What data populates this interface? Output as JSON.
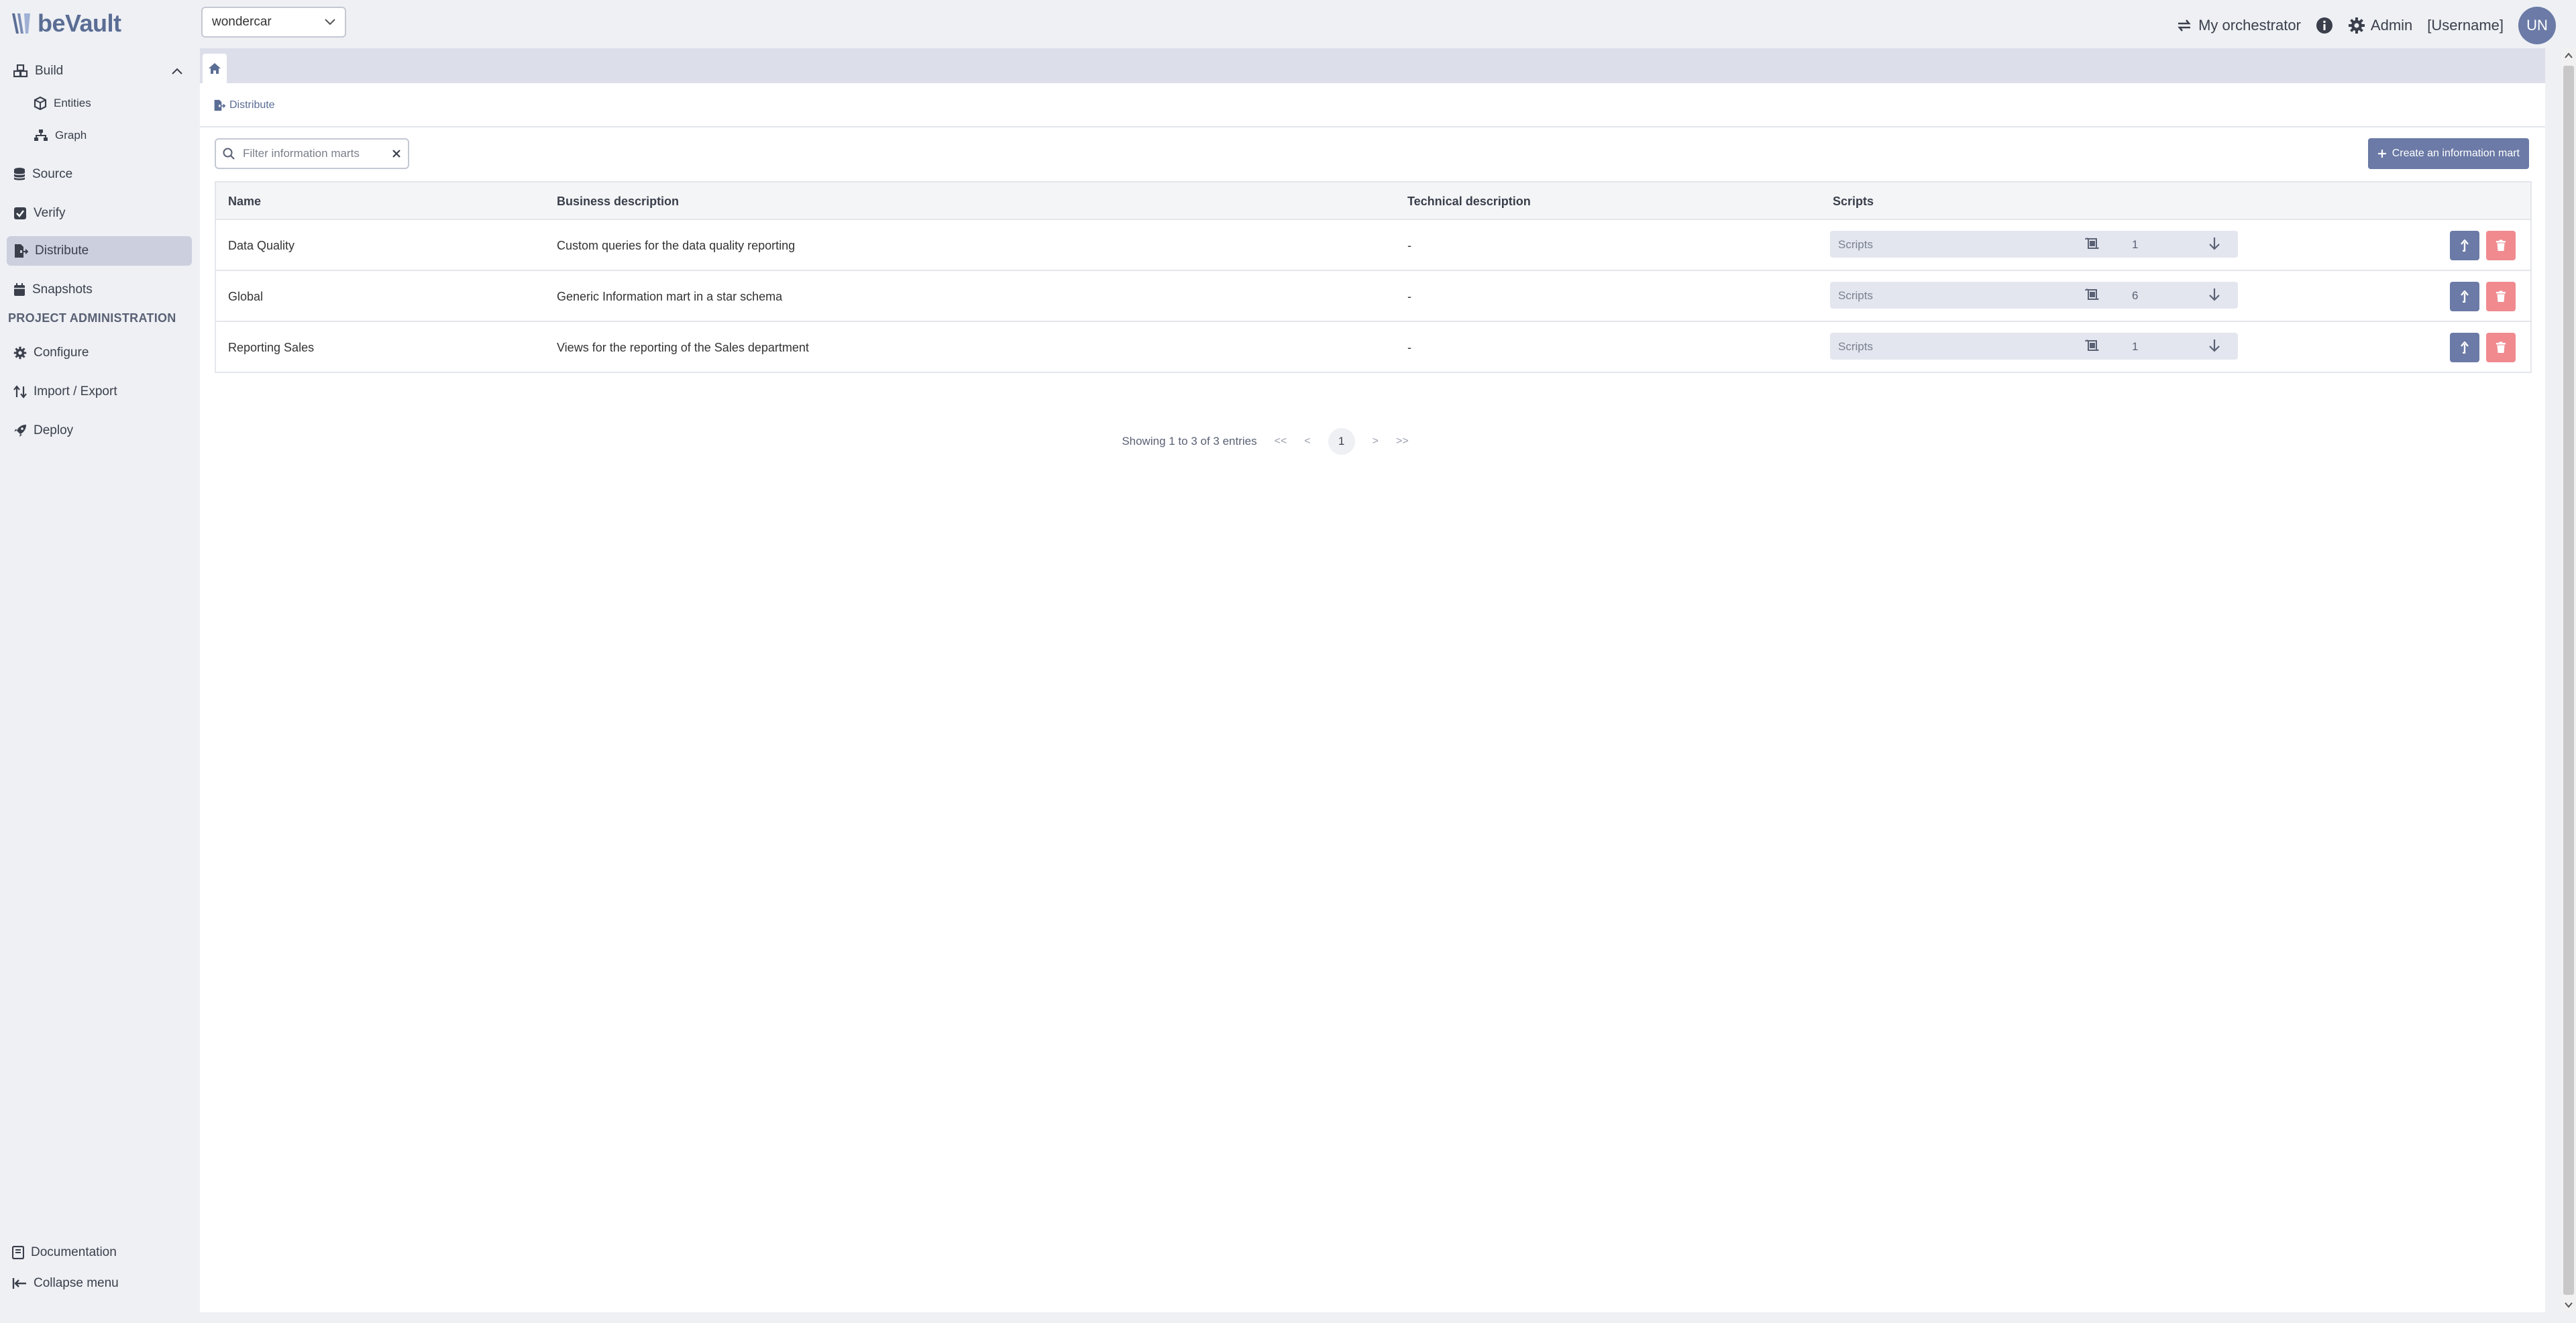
{
  "app": {
    "name": "beVault",
    "project": "wondercar"
  },
  "sidebar": {
    "build": "Build",
    "entities": "Entities",
    "graph": "Graph",
    "source": "Source",
    "verify": "Verify",
    "distribute": "Distribute",
    "snapshots": "Snapshots",
    "admin_section": "PROJECT ADMINISTRATION",
    "configure": "Configure",
    "import_export": "Import / Export",
    "deploy": "Deploy",
    "documentation": "Documentation",
    "collapse": "Collapse menu"
  },
  "header": {
    "orchestrator": "My orchestrator",
    "admin": "Admin",
    "username": "[Username]",
    "avatar": "UN"
  },
  "breadcrumb": "Distribute",
  "toolbar": {
    "filter_placeholder": "Filter information marts",
    "create_label": "Create an information mart"
  },
  "table": {
    "columns": [
      "Name",
      "Business description",
      "Technical description",
      "Scripts"
    ],
    "rows": [
      {
        "name": "Data Quality",
        "business": "Custom queries for the data quality reporting",
        "technical": "-",
        "scripts_label": "Scripts",
        "scripts_count": "1"
      },
      {
        "name": "Global",
        "business": "Generic Information mart in a star schema",
        "technical": "-",
        "scripts_label": "Scripts",
        "scripts_count": "6"
      },
      {
        "name": "Reporting Sales",
        "business": "Views for the reporting of the Sales department",
        "technical": "-",
        "scripts_label": "Scripts",
        "scripts_count": "1"
      }
    ]
  },
  "pagination": {
    "summary": "Showing 1 to 3 of 3 entries",
    "first": "<<",
    "prev": "<",
    "current": "1",
    "next": ">",
    "last": ">>"
  },
  "colors": {
    "accent": "#6b7aa6",
    "danger": "#f08a8f",
    "active_nav": "#ccd0de"
  }
}
